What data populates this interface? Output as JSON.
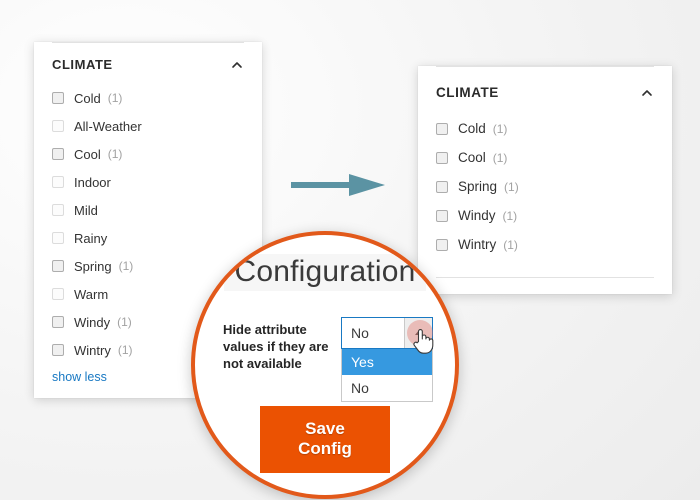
{
  "left_panel": {
    "title": "CLIMATE",
    "collapse_icon": "chevron-up-icon",
    "options": [
      {
        "label": "Cold",
        "count": "(1)",
        "has_count": true
      },
      {
        "label": "All-Weather",
        "count": "",
        "has_count": false
      },
      {
        "label": "Cool",
        "count": "(1)",
        "has_count": true
      },
      {
        "label": "Indoor",
        "count": "",
        "has_count": false
      },
      {
        "label": "Mild",
        "count": "",
        "has_count": false
      },
      {
        "label": "Rainy",
        "count": "",
        "has_count": false
      },
      {
        "label": "Spring",
        "count": "(1)",
        "has_count": true
      },
      {
        "label": "Warm",
        "count": "",
        "has_count": false
      },
      {
        "label": "Windy",
        "count": "(1)",
        "has_count": true
      },
      {
        "label": "Wintry",
        "count": "(1)",
        "has_count": true
      }
    ],
    "show_toggle": "show less"
  },
  "right_panel": {
    "title": "CLIMATE",
    "collapse_icon": "chevron-up-icon",
    "options": [
      {
        "label": "Cold",
        "count": "(1)",
        "has_count": true
      },
      {
        "label": "Cool",
        "count": "(1)",
        "has_count": true
      },
      {
        "label": "Spring",
        "count": "(1)",
        "has_count": true
      },
      {
        "label": "Windy",
        "count": "(1)",
        "has_count": true
      },
      {
        "label": "Wintry",
        "count": "(1)",
        "has_count": true
      }
    ]
  },
  "arrow": {
    "icon": "arrow-right-icon",
    "color": "#5b93a3"
  },
  "spotlight": {
    "title": "Configuration",
    "border_color": "#e2591a",
    "setting": {
      "label": "Hide attribute values if they are not available",
      "select_value": "No",
      "options": [
        {
          "label": "Yes",
          "selected": true
        },
        {
          "label": "No",
          "selected": false
        }
      ],
      "dropdown_open": true
    },
    "save_button": "Save Config",
    "save_button_color": "#eb5202",
    "cursor_icon": "pointer-hand-cursor"
  }
}
